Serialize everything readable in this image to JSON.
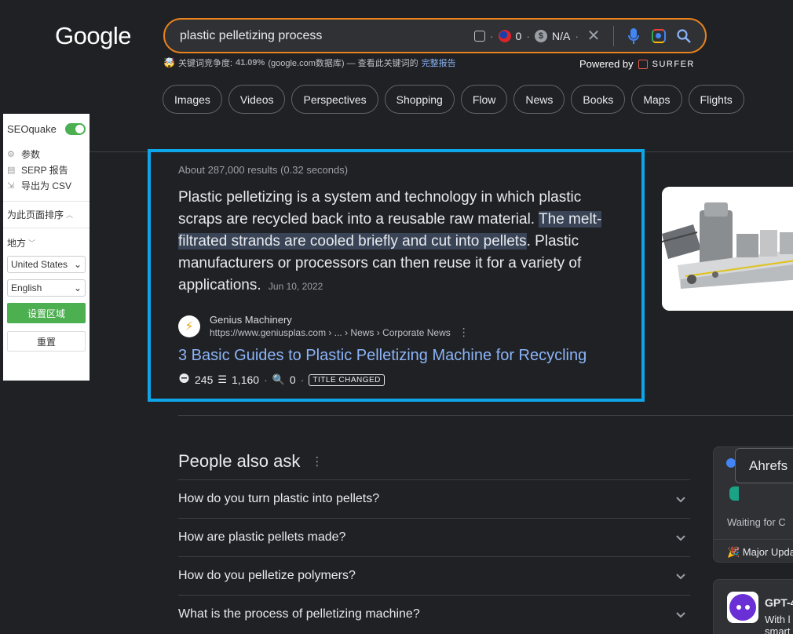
{
  "logo": "Google",
  "search": {
    "query": "plastic pelletizing process",
    "flag_count": "0",
    "na_label": "N/A"
  },
  "keyword_line": {
    "prefix": "关键词竞争度:",
    "percent": "41.09%",
    "middle": "(google.com数据库) — 查看此关键词的",
    "report_link": "完整报告"
  },
  "powered": {
    "label": "Powered by",
    "brand": "SURFER"
  },
  "chips": [
    "Images",
    "Videos",
    "Perspectives",
    "Shopping",
    "Flow",
    "News",
    "Books",
    "Maps",
    "Flights"
  ],
  "seoquake": {
    "title": "SEOquake",
    "menu": [
      "参数",
      "SERP 报告",
      "导出为 CSV"
    ],
    "sort_label": "为此页面排序",
    "local_label": "地方",
    "country": "United States",
    "language": "English",
    "set_region": "设置区域",
    "reset": "重置"
  },
  "featured": {
    "about": "About 287,000 results (0.32 seconds)",
    "snippet_before": "Plastic pelletizing is a system and technology in which plastic scraps are recycled back into a reusable raw material. ",
    "snippet_highlight": "The melt-filtrated strands are cooled briefly and cut into pellets",
    "snippet_after": ". Plastic manufacturers or processors can then reuse it for a variety of applications.",
    "date": "Jun 10, 2022",
    "source_name": "Genius Machinery",
    "source_url": "https://www.geniusplas.com › ... › News › Corporate News",
    "title": "3 Basic Guides to Plastic Pelletizing Machine for Recycling",
    "stat1": "245",
    "stat2": "1,160",
    "stat3": "0",
    "badge": "TITLE CHANGED"
  },
  "paa": {
    "title": "People also ask",
    "questions": [
      "How do you turn plastic into pellets?",
      "How are plastic pellets made?",
      "How do you pelletize polymers?",
      "What is the process of pelletizing machine?"
    ]
  },
  "ahrefs": {
    "tab": "Ahrefs",
    "waiting": "Waiting for C",
    "major": "🎉 Major Upda"
  },
  "gpt": {
    "name": "GPT-4",
    "desc1": "With l",
    "desc2": "smart"
  }
}
